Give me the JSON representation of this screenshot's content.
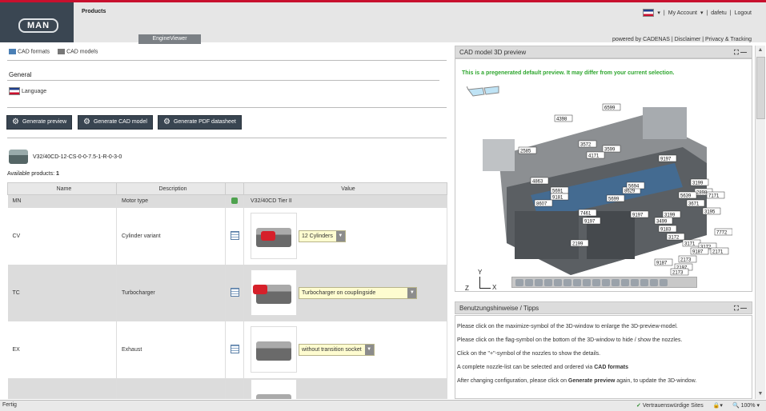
{
  "header": {
    "products_label": "Products",
    "tab": "EngineViewer",
    "my_account": "My Account",
    "user": "dafetu",
    "logout": "Logout",
    "powered": "powered by CADENAS | Disclaimer | Privacy & Tracking",
    "logo_text": "MAN"
  },
  "nav": {
    "cad_formats": "CAD formats",
    "cad_models": "CAD models"
  },
  "general": {
    "title": "General",
    "language": "Language"
  },
  "buttons": {
    "preview": "Generate preview",
    "cad_model": "Generate CAD model",
    "pdf": "Generate PDF datasheet"
  },
  "product": {
    "part_number": "V32/40CD-12-CS-0-0-7.5-1-R-0-3-0",
    "available_label": "Available products:",
    "available_count": "1"
  },
  "table": {
    "headers": {
      "name": "Name",
      "description": "Description",
      "value": "Value"
    },
    "rows": [
      {
        "name": "MN",
        "description": "Motor type",
        "value": "V32/40CD Tier II"
      },
      {
        "name": "CV",
        "description": "Cylinder variant",
        "value": "12 Cylinders"
      },
      {
        "name": "TC",
        "description": "Turbocharger",
        "value": "Turbocharger on couplingside"
      },
      {
        "name": "EX",
        "description": "Exhaust",
        "value": "without transition socket"
      }
    ]
  },
  "preview_panel": {
    "title": "CAD model 3D preview",
    "note": "This is a pregenerated default preview. It may differ from your current selection.",
    "axis_x": "X",
    "axis_y": "Y",
    "axis_z": "Z",
    "labels": [
      "6599",
      "4398",
      "2585",
      "3572",
      "3599",
      "4171",
      "9197",
      "4863",
      "5691",
      "9181",
      "8607",
      "7461",
      "9197",
      "3199",
      "2898",
      "7171",
      "5639",
      "3671",
      "3195",
      "5699",
      "3199",
      "3499",
      "9183",
      "3172",
      "7772",
      "9197",
      "2199",
      "3171",
      "3172",
      "2171",
      "9187",
      "2173",
      "2197",
      "9187",
      "2173",
      "8629",
      "5694"
    ]
  },
  "tips_panel": {
    "title": "Benutzungshinweise / Tipps",
    "tip1": "Please click on the maximize-symbol of the 3D-window to enlarge the 3D-preview-model.",
    "tip2": "Please click on the flag-symbol on the bottom of the 3D-window to hide / show the nozzles.",
    "tip3": "Click on the \"+\"-symbol of the nozzles to show the details.",
    "tip4_pre": "A complete nozzle-list can be selected and ordered via ",
    "tip4_bold": "CAD formats",
    "tip5_pre": "After changing configuration, please click on ",
    "tip5_bold": "Generate preview",
    "tip5_post": " again, to update the 3D-window."
  },
  "status": {
    "left": "Fertig",
    "trusted": "Vertrauenswürdige Sites",
    "zoom": "100%"
  },
  "colors": {
    "accent_red": "#c8102e",
    "button_dark": "#394551",
    "preview_note": "#2ea62e",
    "select_bg": "#fefcd0"
  }
}
